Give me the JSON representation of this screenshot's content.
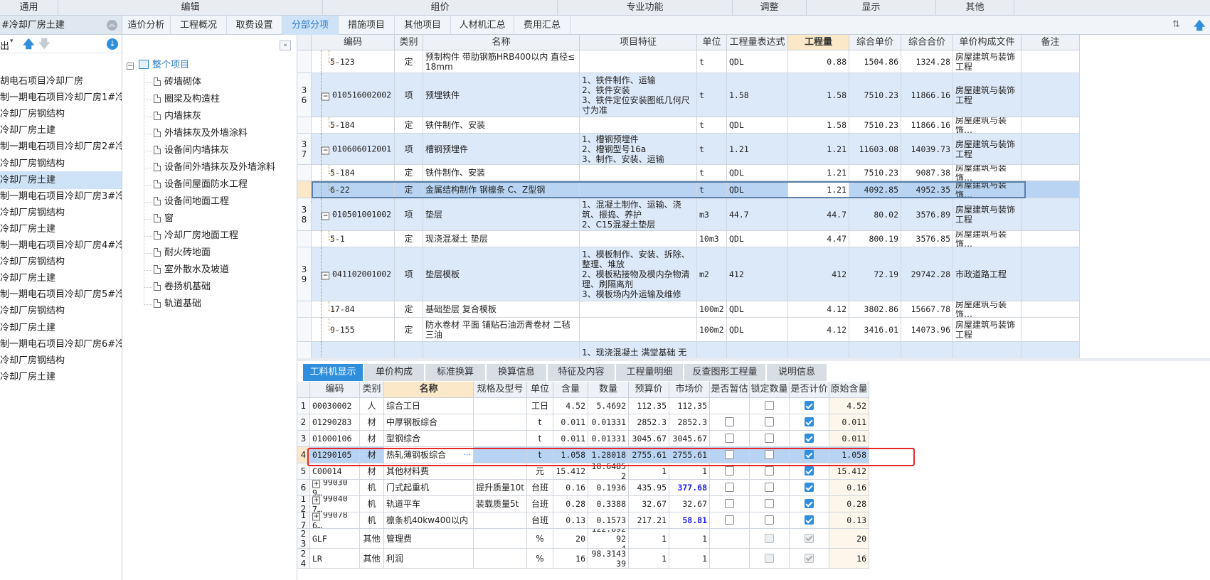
{
  "menu": [
    "通用",
    "编辑",
    "组价",
    "专业功能",
    "调整",
    "显示",
    "其他"
  ],
  "left_panel": {
    "title": "#冷却厂房土建",
    "toolbar_label": "出",
    "rows": [
      "胡电石项目冷却厂房",
      "制一期电石项目冷却厂房1#冷…",
      "冷却厂房钢结构",
      "冷却厂房土建",
      "制一期电石项目冷却厂房2#冷…",
      "冷却厂房钢结构",
      "冷却厂房土建",
      "制一期电石项目冷却厂房3#冷…",
      "冷却厂房钢结构",
      "冷却厂房土建",
      "制一期电石项目冷却厂房4#冷…",
      "冷却厂房钢结构",
      "冷却厂房土建",
      "制一期电石项目冷却厂房5#冷…",
      "冷却厂房钢结构",
      "冷却厂房土建",
      "制一期电石项目冷却厂房6#冷…",
      "冷却厂房钢结构",
      "冷却厂房土建"
    ]
  },
  "tabs": [
    "造价分析",
    "工程概况",
    "取费设置",
    "分部分项",
    "措施项目",
    "其他项目",
    "人材机汇总",
    "费用汇总"
  ],
  "tree": {
    "root": "整个项目",
    "items": [
      "砖墙砌体",
      "圈梁及构造柱",
      "内墙抹灰",
      "外墙抹灰及外墙涂料",
      "设备间内墙抹灰",
      "设备间外墙抹灰及外墙涂料",
      "设备间屋面防水工程",
      "设备间地面工程",
      "窗",
      "冷却厂房地面工程",
      "耐火砖地面",
      "室外散水及坡道",
      "卷扬机基础",
      "轨道基础"
    ]
  },
  "top_grid": {
    "headers": [
      "编码",
      "类别",
      "名称",
      "项目特征",
      "单位",
      "工程量表达式",
      "工程量",
      "综合单价",
      "综合合价",
      "单价构成文件",
      "备注"
    ],
    "rows": [
      {
        "no": "",
        "code": "5-123",
        "type": "定",
        "name": "预制构件 带肋钢筋HRB400以内 直径≤18mm",
        "feature": "",
        "unit": "t",
        "expr": "QDL",
        "qty": "0.88",
        "price": "1504.86",
        "total": "1324.28",
        "file": "房屋建筑与装饰工程",
        "level": 2
      },
      {
        "no": "36",
        "code": "010516002002",
        "type": "项",
        "name": "预埋铁件",
        "feature": "1、铁件制作、运输\n2、铁件安装\n3、铁件定位安装图纸几何尺寸为准",
        "unit": "t",
        "expr": "1.58",
        "qty": "1.58",
        "price": "7510.23",
        "total": "11866.16",
        "file": "房屋建筑与装饰工程",
        "level": 1
      },
      {
        "no": "",
        "code": "5-184",
        "type": "定",
        "name": "铁件制作、安装",
        "feature": "",
        "unit": "t",
        "expr": "QDL",
        "qty": "1.58",
        "price": "7510.23",
        "total": "11866.16",
        "file": "房屋建筑与装饰…",
        "level": 2
      },
      {
        "no": "37",
        "code": "010606012001",
        "type": "项",
        "name": "槽钢预埋件",
        "feature": "1、槽钢预埋件\n2、槽钢型号16a\n3、制作、安装、运输",
        "unit": "t",
        "expr": "1.21",
        "qty": "1.21",
        "price": "11603.08",
        "total": "14039.73",
        "file": "房屋建筑与装饰工程",
        "level": 1
      },
      {
        "no": "",
        "code": "5-184",
        "type": "定",
        "name": "铁件制作、安装",
        "feature": "",
        "unit": "t",
        "expr": "QDL",
        "qty": "1.21",
        "price": "7510.23",
        "total": "9087.38",
        "file": "房屋建筑与装饰…",
        "level": 2
      },
      {
        "no": "",
        "code": "6-22",
        "type": "定",
        "name": "金属结构制作 钢檩条 C、Z型钢",
        "feature": "",
        "unit": "t",
        "expr": "QDL",
        "qty": "1.21",
        "price": "4092.85",
        "total": "4952.35",
        "file": "房屋建筑与装饰…",
        "level": 2
      },
      {
        "no": "38",
        "code": "010501001002",
        "type": "项",
        "name": "垫层",
        "feature": "1、混凝土制作、运输、浇筑、振捣、养护\n2、C15混凝土垫层",
        "unit": "m3",
        "expr": "44.7",
        "qty": "44.7",
        "price": "80.02",
        "total": "3576.89",
        "file": "房屋建筑与装饰工程",
        "level": 1
      },
      {
        "no": "",
        "code": "5-1",
        "type": "定",
        "name": "现浇混凝土 垫层",
        "feature": "",
        "unit": "10m3",
        "expr": "QDL",
        "qty": "4.47",
        "price": "800.19",
        "total": "3576.85",
        "file": "房屋建筑与装饰…",
        "level": 2
      },
      {
        "no": "39",
        "code": "041102001002",
        "type": "项",
        "name": "垫层模板",
        "feature": "1、模板制作、安装、拆除、整理、堆放\n2、模板粘接物及模内杂物清理、刷隔离剂\n3、模板场内外运输及维修",
        "unit": "m2",
        "expr": "412",
        "qty": "412",
        "price": "72.19",
        "total": "29742.28",
        "file": "市政道路工程",
        "level": 1
      },
      {
        "no": "",
        "code": "17-84",
        "type": "定",
        "name": "基础垫层 复合模板",
        "feature": "",
        "unit": "100m2",
        "expr": "QDL",
        "qty": "4.12",
        "price": "3802.86",
        "total": "15667.78",
        "file": "房屋建筑与装饰…",
        "level": 2
      },
      {
        "no": "",
        "code": "9-155",
        "type": "定",
        "name": "防水卷材 平面 铺贴石油沥青卷材 二毡三油",
        "feature": "",
        "unit": "100m2",
        "expr": "QDL",
        "qty": "4.12",
        "price": "3416.01",
        "total": "14073.96",
        "file": "房屋建筑与装饰工程",
        "level": 2
      },
      {
        "no": "",
        "code": "",
        "type": "",
        "name": "",
        "feature": "1、现浇混凝土 满堂基础 无",
        "unit": "",
        "expr": "",
        "qty": "",
        "price": "",
        "total": "",
        "file": "",
        "level": 1
      }
    ]
  },
  "sub_tabs": [
    "工料机显示",
    "单价构成",
    "标准换算",
    "换算信息",
    "特征及内容",
    "工程量明细",
    "反查图形工程量",
    "说明信息"
  ],
  "bottom_grid": {
    "headers": [
      "编码",
      "类别",
      "名称",
      "规格及型号",
      "单位",
      "含量",
      "数量",
      "预算价",
      "市场价",
      "是否暂估",
      "锁定数量",
      "是否计价",
      "原始含量"
    ],
    "rows": [
      {
        "no": "1",
        "code": "00030002",
        "type": "人",
        "name": "综合工日",
        "spec": "",
        "unit": "工日",
        "content": "4.52",
        "qty": "5.4692",
        "budget": "112.35",
        "market": "112.35",
        "est": "none",
        "lock": "off",
        "priced": "on",
        "orig": "4.52"
      },
      {
        "no": "2",
        "code": "01290283",
        "type": "材",
        "name": "中厚钢板综合",
        "spec": "",
        "unit": "t",
        "content": "0.011",
        "qty": "0.01331",
        "budget": "2852.3",
        "market": "2852.3",
        "est": "off",
        "lock": "off",
        "priced": "on",
        "orig": "0.011"
      },
      {
        "no": "3",
        "code": "01000106",
        "type": "材",
        "name": "型钢综合",
        "spec": "",
        "unit": "t",
        "content": "0.011",
        "qty": "0.01331",
        "budget": "3045.67",
        "market": "3045.67",
        "est": "off",
        "lock": "off",
        "priced": "on",
        "orig": "0.011"
      },
      {
        "no": "4",
        "code": "01290105",
        "type": "材",
        "name": "热轧薄钢板综合",
        "spec": "",
        "unit": "t",
        "content": "1.058",
        "qty": "1.28018",
        "budget": "2755.61",
        "market": "2755.61",
        "est": "off",
        "lock": "off",
        "priced": "on",
        "orig": "1.058"
      },
      {
        "no": "5",
        "code": "C00014",
        "type": "材",
        "name": "其他材料费",
        "spec": "",
        "unit": "元",
        "content": "15.412",
        "qty": "18.64852",
        "budget": "1",
        "market": "1",
        "est": "off",
        "lock": "off",
        "priced": "on",
        "orig": "15.412"
      },
      {
        "no": "6",
        "code": "990309…",
        "type": "机",
        "name": "门式起重机",
        "spec": "提升质量10t",
        "unit": "台班",
        "content": "0.16",
        "qty": "0.1936",
        "budget": "435.95",
        "market": "377.68",
        "est": "off",
        "lock": "off",
        "priced": "on",
        "orig": "0.16",
        "exp": true,
        "market_hl": true
      },
      {
        "no": "12",
        "code": "990407…",
        "type": "机",
        "name": "轨道平车",
        "spec": "装载质量5t",
        "unit": "台班",
        "content": "0.28",
        "qty": "0.3388",
        "budget": "32.67",
        "market": "32.67",
        "est": "off",
        "lock": "off",
        "priced": "on",
        "orig": "0.28",
        "exp": true
      },
      {
        "no": "17",
        "code": "990786…",
        "type": "机",
        "name": "檩条机40kw400以内",
        "spec": "",
        "unit": "台班",
        "content": "0.13",
        "qty": "0.1573",
        "budget": "217.21",
        "market": "58.81",
        "est": "off",
        "lock": "off",
        "priced": "on",
        "orig": "0.13",
        "exp": true,
        "market_hl": true
      },
      {
        "no": "23",
        "code": "GLF",
        "type": "其他",
        "name": "管理费",
        "spec": "",
        "unit": "%",
        "content": "20",
        "qty": "122.89292\n4",
        "budget": "1",
        "market": "1",
        "est": "none",
        "lock": "dis",
        "priced": "disOn",
        "orig": "20"
      },
      {
        "no": "24",
        "code": "LR",
        "type": "其他",
        "name": "利润",
        "spec": "",
        "unit": "%",
        "content": "16",
        "qty": "98.314339",
        "budget": "1",
        "market": "1",
        "est": "none",
        "lock": "dis",
        "priced": "disOn",
        "orig": "16"
      }
    ]
  },
  "colors": {
    "accent": "#2f8fdd",
    "highlight_border": "#e8262a",
    "market_highlight": "#1a1aff"
  }
}
